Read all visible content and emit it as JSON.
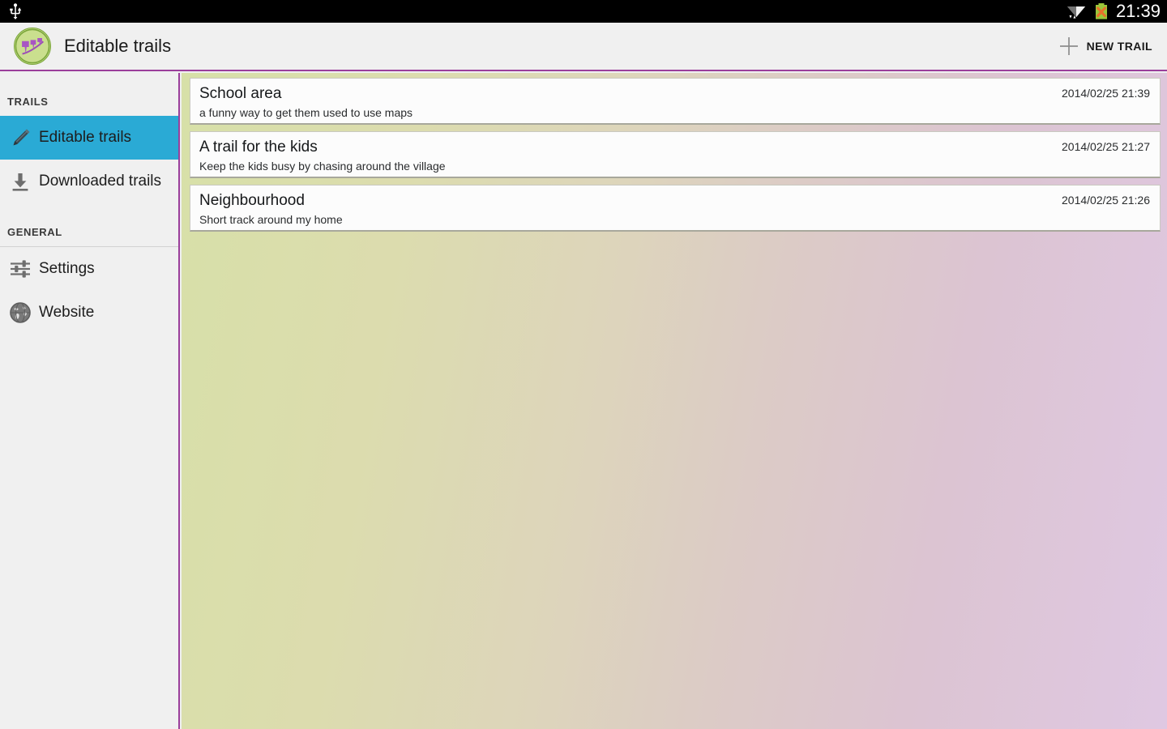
{
  "status_bar": {
    "usb_icon": "usb-icon",
    "wifi_icon": "wifi-icon",
    "battery_icon": "battery-no-charge-icon",
    "clock": "21:39"
  },
  "action_bar": {
    "logo_icon": "app-logo-trail-pins-icon",
    "title": "Editable trails",
    "new_trail": {
      "icon": "plus-icon",
      "label": "NEW TRAIL"
    },
    "accent_color": "#9b3f9b"
  },
  "sidebar": {
    "sections": [
      {
        "header": "TRAILS",
        "items": [
          {
            "label": "Editable trails",
            "icon": "pencil-icon",
            "selected": true
          },
          {
            "label": "Downloaded trails",
            "icon": "download-icon",
            "selected": false
          }
        ]
      },
      {
        "header": "GENERAL",
        "items": [
          {
            "label": "Settings",
            "icon": "sliders-icon",
            "selected": false
          },
          {
            "label": "Website",
            "icon": "globe-icon",
            "selected": false
          }
        ]
      }
    ],
    "selected_color": "#2aaad5"
  },
  "main": {
    "trails": [
      {
        "title": "School area",
        "description": "a funny way to get them used to use maps",
        "date": "2014/02/25 21:39"
      },
      {
        "title": "A trail for the kids",
        "description": "Keep the kids busy by chasing around the village",
        "date": "2014/02/25 21:27"
      },
      {
        "title": "Neighbourhood",
        "description": "Short track around my home",
        "date": "2014/02/25 21:26"
      }
    ]
  }
}
